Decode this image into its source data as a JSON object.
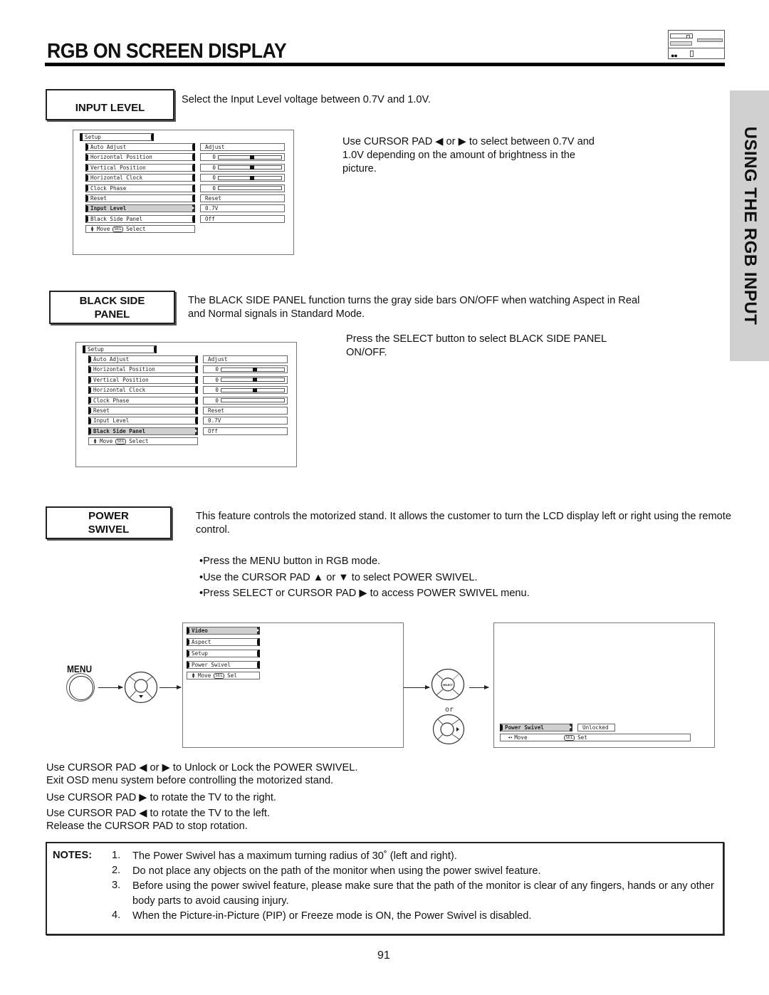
{
  "header": {
    "title": "RGB ON SCREEN DISPLAY",
    "side_tab": "USING THE RGB INPUT",
    "device_icon": "tv-device-icon"
  },
  "input_level": {
    "label": "INPUT LEVEL",
    "intro": "Select the Input Level voltage between 0.7V and 1.0V.",
    "detail": "Use CURSOR PAD ◀ or ▶ to select between 0.7V and 1.0V depending on the amount of brightness in the picture.",
    "osd": {
      "title": "Setup",
      "items": [
        {
          "label": "Auto Adjust",
          "value": "Adjust",
          "slider": null
        },
        {
          "label": "Horizontal Position",
          "value": "0",
          "slider": 0.5
        },
        {
          "label": "Vertical Position",
          "value": "0",
          "slider": 0.5
        },
        {
          "label": "Horizontal Clock",
          "value": "0",
          "slider": 0.5
        },
        {
          "label": "Clock Phase",
          "value": "0",
          "slider": 0.0
        },
        {
          "label": "Reset",
          "value": "Reset",
          "slider": null
        },
        {
          "label": "Input Level",
          "value": "0.7V",
          "slider": null
        },
        {
          "label": "Black Side Panel",
          "value": "Off",
          "slider": null
        }
      ],
      "selected_index": 6,
      "help": {
        "move": "Move",
        "sel": "SEL",
        "select": "Select"
      }
    }
  },
  "black_side_panel": {
    "label_line1": "BLACK SIDE",
    "label_line2": "PANEL",
    "intro": "The BLACK SIDE PANEL function turns the gray side bars ON/OFF when watching Aspect in Real and Normal signals in Standard Mode.",
    "detail": "Press the SELECT button to select BLACK SIDE PANEL ON/OFF.",
    "osd": {
      "title": "Setup",
      "items": [
        {
          "label": "Auto Adjust",
          "value": "Adjust",
          "slider": null
        },
        {
          "label": "Horizontal Position",
          "value": "0",
          "slider": 0.5
        },
        {
          "label": "Vertical Position",
          "value": "0",
          "slider": 0.5
        },
        {
          "label": "Horizontal Clock",
          "value": "0",
          "slider": 0.5
        },
        {
          "label": "Clock Phase",
          "value": "0",
          "slider": 0.0
        },
        {
          "label": "Reset",
          "value": "Reset",
          "slider": null
        },
        {
          "label": "Input Level",
          "value": "0.7V",
          "slider": null
        },
        {
          "label": "Black Side Panel",
          "value": "Off",
          "slider": null
        }
      ],
      "selected_index": 7,
      "help": {
        "move": "Move",
        "sel": "SEL",
        "select": "Select"
      }
    }
  },
  "power_swivel": {
    "label_line1": "POWER",
    "label_line2": "SWIVEL",
    "intro": "This feature controls the motorized stand.  It allows the customer to turn the LCD display left or right using the remote control.",
    "steps": [
      "•Press the MENU button in RGB mode.",
      "•Use the CURSOR PAD ▲ or ▼ to select POWER SWIVEL.",
      "•Press SELECT or CURSOR PAD ▶ to access POWER SWIVEL menu."
    ],
    "diagram": {
      "menu_label": "MENU",
      "or_text": "or",
      "select_text": "SELECT",
      "main_menu": {
        "items": [
          "Video",
          "Aspect",
          "Setup",
          "Power Swivel"
        ],
        "selected_index": 0,
        "help": {
          "move": "Move",
          "sel": "SEL",
          "select": "Sel"
        }
      },
      "swivel_menu": {
        "label": "Power Swivel",
        "value": "Unlocked",
        "help": {
          "move": "Move",
          "sel": "SEL",
          "set": "Set"
        }
      }
    },
    "instructions": [
      "Use CURSOR PAD ◀ or ▶ to Unlock or Lock the POWER SWIVEL.",
      "Exit OSD menu system before controlling the motorized stand.",
      "Use CURSOR PAD ▶ to rotate the TV to the right.",
      "Use CURSOR PAD ◀ to rotate the TV to the left.",
      "Release the CURSOR PAD to stop rotation."
    ]
  },
  "notes": {
    "label": "NOTES:",
    "items": [
      {
        "num": "1.",
        "text": "The Power Swivel has a maximum turning radius of 30˚ (left and right)."
      },
      {
        "num": "2.",
        "text": "Do not place any objects on the path of the monitor when using the power swivel feature."
      },
      {
        "num": "3.",
        "text": "Before using the power swivel feature, please make sure that the path of the monitor is clear of any fingers, hands or any other body parts to avoid causing injury."
      },
      {
        "num": "4.",
        "text": "When the Picture-in-Picture (PIP) or Freeze mode is ON, the Power Swivel is disabled."
      }
    ]
  },
  "footer": {
    "page_number": "91"
  }
}
